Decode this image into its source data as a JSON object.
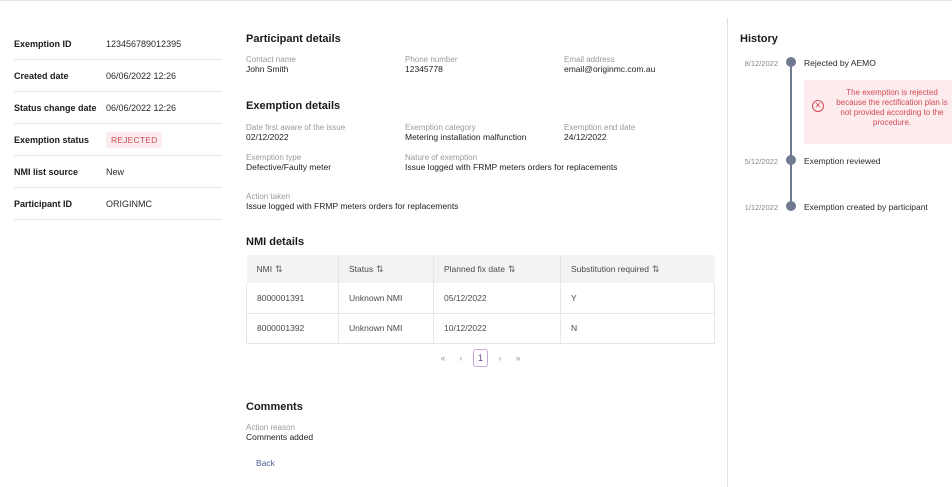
{
  "summary": {
    "rows": [
      {
        "label": "Exemption ID",
        "value": "123456789012395"
      },
      {
        "label": "Created date",
        "value": "06/06/2022 12:26"
      },
      {
        "label": "Status change date",
        "value": "06/06/2022 12:26"
      },
      {
        "label": "Exemption status",
        "value": "REJECTED"
      },
      {
        "label": "NMI list source",
        "value": "New"
      },
      {
        "label": "Participant ID",
        "value": "ORIGINMC"
      }
    ]
  },
  "participant": {
    "title": "Participant details",
    "contact_label": "Contact name",
    "contact_value": "John Smith",
    "phone_label": "Phone number",
    "phone_value": "12345778",
    "email_label": "Email address",
    "email_value": "email@originmc.com.au"
  },
  "exemption": {
    "title": "Exemption details",
    "first_aware_label": "Date first aware of the issue",
    "first_aware_value": "02/12/2022",
    "category_label": "Exemption category",
    "category_value": "Metering installation malfunction",
    "end_date_label": "Exemption end date",
    "end_date_value": "24/12/2022",
    "type_label": "Exemption type",
    "type_value": "Defective/Faulty meter",
    "nature_label": "Nature of exemption",
    "nature_value": "Issue logged with FRMP meters orders for replacements",
    "action_label": "Action taken",
    "action_value": "Issue logged with FRMP meters orders for replacements"
  },
  "nmi": {
    "title": "NMI details",
    "columns": [
      "NMI",
      "Status",
      "Planned fix date",
      "Substitution required"
    ],
    "sort_icon": "⇅",
    "rows": [
      [
        "8000001391",
        "Unknown NMI",
        "05/12/2022",
        "Y"
      ],
      [
        "8000001392",
        "Unknown NMI",
        "10/12/2022",
        "N"
      ]
    ],
    "pager": {
      "first": "«",
      "prev": "‹",
      "current": "1",
      "next": "›",
      "last": "»"
    }
  },
  "comments": {
    "title": "Comments",
    "reason_label": "Action reason",
    "reason_value": "Comments added"
  },
  "back_label": "Back",
  "history": {
    "title": "History",
    "events": [
      {
        "date": "8/12/2022",
        "text": "Rejected by AEMO"
      },
      {
        "date": "5/12/2022",
        "text": "Exemption reviewed"
      },
      {
        "date": "1/12/2022",
        "text": "Exemption created by participant"
      }
    ],
    "rejection_message": "The exemption is rejected because the rectification plan is not provided according to the procedure."
  },
  "colors": {
    "reject_red": "#d14a55",
    "reject_bg": "#fdecee",
    "timeline": "#6f7a8e",
    "link": "#4f5a93"
  }
}
